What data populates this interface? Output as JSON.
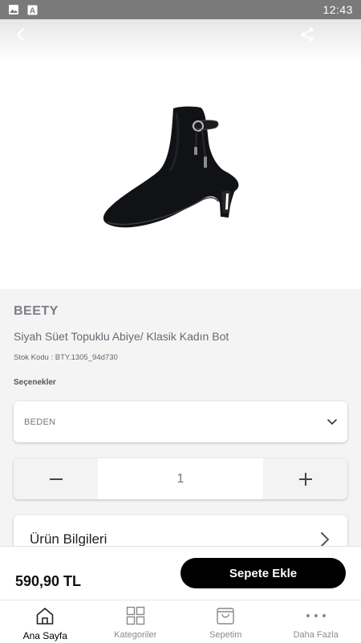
{
  "status_bar": {
    "time": "12:43"
  },
  "product": {
    "brand": "BEETY",
    "name": "Siyah Süet Topuklu Abiye/ Klasik Kadın Bot",
    "sku": "Stok Kodu : BTY.1305_94d730",
    "options_label": "Seçenekler",
    "size_select": "BEDEN",
    "quantity": "1",
    "info_label": "Ürün Bilgileri"
  },
  "buy_bar": {
    "price": "590,90 TL",
    "add_to_cart": "Sepete Ekle"
  },
  "tabs": [
    {
      "label": "Ana Sayfa",
      "icon": "home-icon",
      "active": true
    },
    {
      "label": "Kategoriler",
      "icon": "grid-icon",
      "active": false
    },
    {
      "label": "Sepetim",
      "icon": "cart-icon",
      "active": false
    },
    {
      "label": "Daha Fazla",
      "icon": "more-icon",
      "active": false
    }
  ],
  "colors": {
    "accent": "#000000",
    "muted_text": "#7b7e86"
  }
}
